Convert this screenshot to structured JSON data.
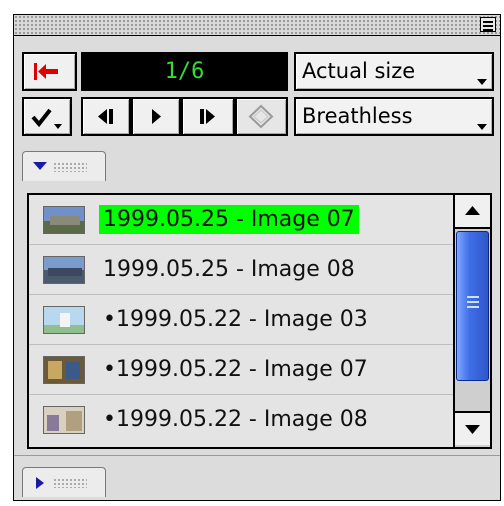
{
  "window": {
    "counter": "1/6",
    "view_mode": "Actual size",
    "album": "Breathless"
  },
  "toolbar": {
    "back_to_start_icon": "back-to-start-icon",
    "checkmark_icon": "checkmark-menu-icon",
    "prev_icon": "step-back-icon",
    "play_icon": "play-icon",
    "next_icon": "step-forward-icon",
    "diamond_icon": "diamond-icon",
    "accent_red": "#e00000",
    "counter_color": "#33dd33"
  },
  "list": {
    "highlight_color": "#00ff00",
    "items": [
      {
        "label": "1999.05.25 - Image 07",
        "selected": true
      },
      {
        "label": "1999.05.25 - Image 08",
        "selected": false
      },
      {
        "label": "•1999.05.22 - Image 03",
        "selected": false
      },
      {
        "label": "•1999.05.22 - Image 07",
        "selected": false
      },
      {
        "label": "•1999.05.22 - Image 08",
        "selected": false
      }
    ]
  }
}
